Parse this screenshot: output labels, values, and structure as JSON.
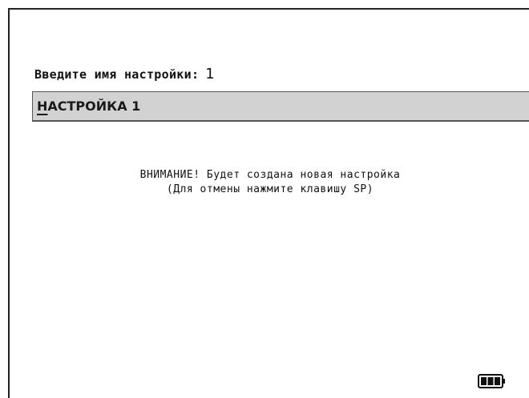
{
  "prompt": {
    "label": "Введите имя настройки:",
    "value": "1"
  },
  "name_field": {
    "first_char": "Н",
    "rest": "АСТРОЙКА 1"
  },
  "warning": {
    "line1": "ВНИМАНИЕ! Будет создана новая настройка",
    "line2": "(Для отмены нажмите клавишу SP)"
  },
  "battery": {
    "icon": "battery-icon",
    "bars_filled": 3,
    "bars_total": 3
  }
}
